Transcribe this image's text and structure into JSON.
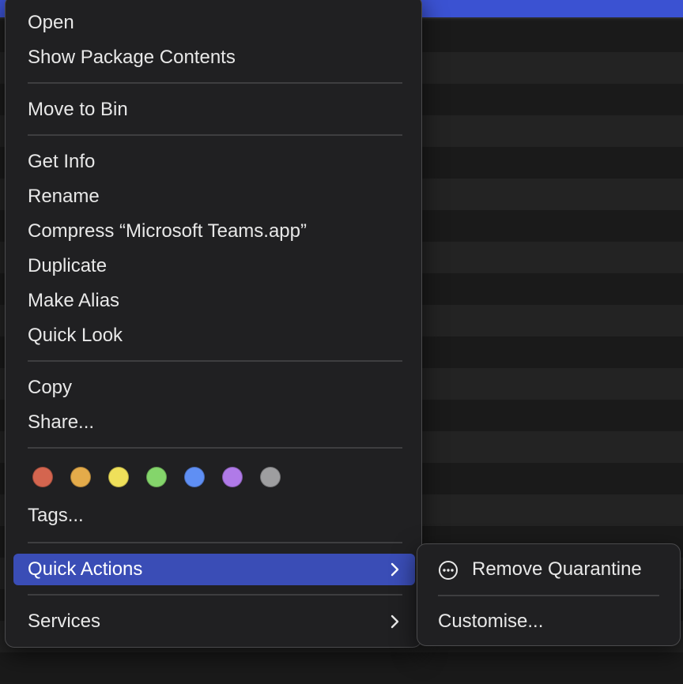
{
  "menu": {
    "items": [
      {
        "label": "Open"
      },
      {
        "label": "Show Package Contents"
      },
      {
        "label": "Move to Bin"
      },
      {
        "label": "Get Info"
      },
      {
        "label": "Rename"
      },
      {
        "label": "Compress “Microsoft Teams.app”"
      },
      {
        "label": "Duplicate"
      },
      {
        "label": "Make Alias"
      },
      {
        "label": "Quick Look"
      },
      {
        "label": "Copy"
      },
      {
        "label": "Share..."
      },
      {
        "label": "Tags..."
      },
      {
        "label": "Quick Actions",
        "selected": true,
        "has_submenu": true
      },
      {
        "label": "Services",
        "has_submenu": true
      }
    ],
    "tag_colors": [
      {
        "name": "red",
        "color": "#d4654f"
      },
      {
        "name": "orange",
        "color": "#e4ab4a"
      },
      {
        "name": "yellow",
        "color": "#efe05a"
      },
      {
        "name": "green",
        "color": "#84d56b"
      },
      {
        "name": "blue",
        "color": "#5f8ff4"
      },
      {
        "name": "purple",
        "color": "#b07ae8"
      },
      {
        "name": "gray",
        "color": "#9e9ea0"
      }
    ]
  },
  "submenu": {
    "items": [
      {
        "label": "Remove Quarantine",
        "icon": "ellipsis-circle-icon"
      },
      {
        "label": "Customise..."
      }
    ]
  },
  "colors": {
    "accent": "#3a4db6",
    "menu_background": "#202022",
    "titlebar_highlight": "#3b52d2"
  }
}
